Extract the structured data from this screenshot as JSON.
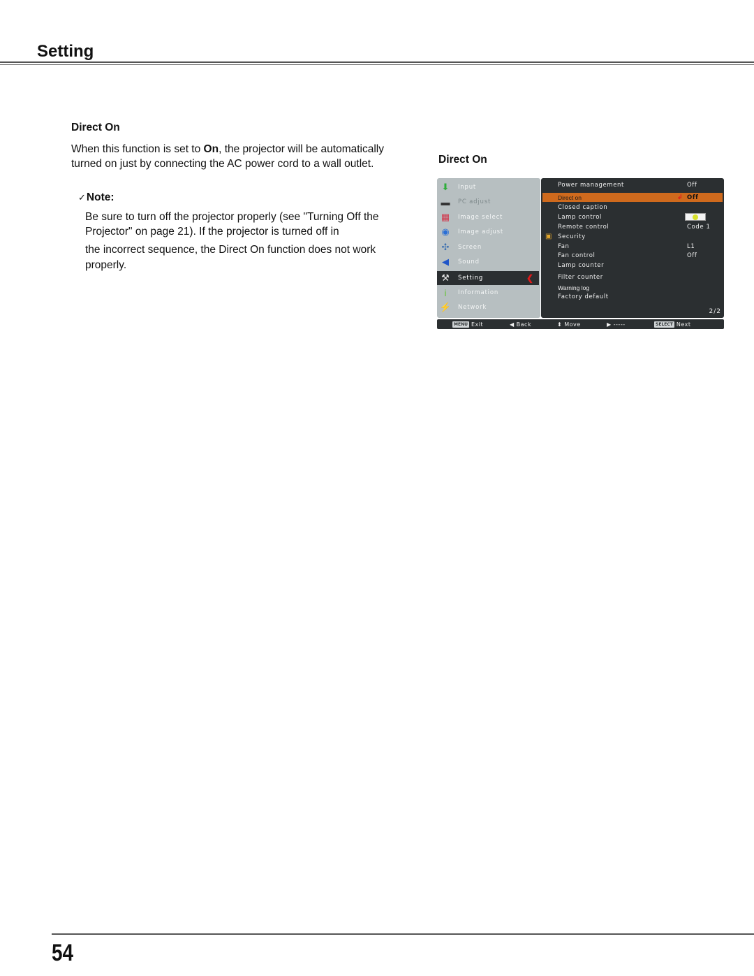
{
  "header": {
    "section_title": "Setting"
  },
  "content": {
    "heading": "Direct On",
    "para_before": "When this function is set to ",
    "para_bold": "On",
    "para_after": ", the projector will be automatically turned on just by connecting the AC power cord to a wall outlet.",
    "note_check": "✓",
    "note_label": "Note:",
    "note_line1": "Be sure to turn off the projector properly (see \"Turning Off the Projector\" on page 21). If the projector is turned off in",
    "note_line2": "the incorrect sequence, the Direct On function does not work properly."
  },
  "figure": {
    "caption": "Direct On",
    "menu": [
      {
        "label": "Input",
        "icon": "input-icon",
        "glyph": "⬇",
        "color": "#2fae3b"
      },
      {
        "label": "PC adjust",
        "icon": "pc-adjust-icon",
        "glyph": "▬",
        "color": "#333333"
      },
      {
        "label": "Image select",
        "icon": "image-select-icon",
        "glyph": "▦",
        "color": "#d2354a"
      },
      {
        "label": "Image adjust",
        "icon": "image-adjust-icon",
        "glyph": "◉",
        "color": "#2a6fd6"
      },
      {
        "label": "Screen",
        "icon": "screen-icon",
        "glyph": "✣",
        "color": "#3b6fb0"
      },
      {
        "label": "Sound",
        "icon": "sound-icon",
        "glyph": "◀",
        "color": "#1f55c8"
      },
      {
        "label": "Setting",
        "icon": "setting-icon",
        "glyph": "⚒",
        "color": "#e8e8e8"
      },
      {
        "label": "Information",
        "icon": "information-icon",
        "glyph": "i",
        "color": "#61c52f"
      },
      {
        "label": "Network",
        "icon": "network-icon",
        "glyph": "⚡",
        "color": "#e2d32a"
      }
    ],
    "active_menu": "Setting",
    "settings": [
      {
        "label": "Power management",
        "value": "Off"
      },
      {
        "label": "Direct on",
        "value": "Off"
      },
      {
        "label": "Closed caption",
        "value": ""
      },
      {
        "label": "Lamp control",
        "value": ""
      },
      {
        "label": "Remote control",
        "value": "Code 1"
      },
      {
        "label": "Security",
        "value": ""
      },
      {
        "label": "Fan",
        "value": "L1"
      },
      {
        "label": "Fan control",
        "value": "Off"
      },
      {
        "label": "Lamp counter",
        "value": ""
      },
      {
        "label": "Filter counter",
        "value": ""
      },
      {
        "label": "Warning log",
        "value": ""
      },
      {
        "label": "Factory default",
        "value": ""
      }
    ],
    "page_indicator": "2/2",
    "guide_bar": {
      "menu_key": "MENU",
      "exit": "Exit",
      "back": "Back",
      "move": "Move",
      "right": "-----",
      "select_key": "SELECT",
      "next": "Next"
    }
  },
  "footer": {
    "page_number": "54"
  }
}
